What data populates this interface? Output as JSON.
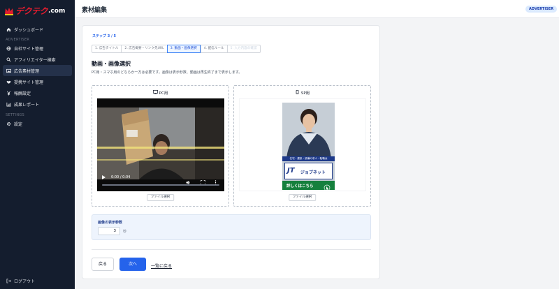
{
  "brand": {
    "logo_text": "デクテク",
    "logo_suffix": ".com",
    "accent_color": "#e11d2e"
  },
  "sidebar": {
    "main_items": [
      {
        "label": "ダッシュボード",
        "icon": "home-icon"
      }
    ],
    "sections": [
      {
        "title": "ADVERTISER",
        "items": [
          {
            "label": "自社サイト管理",
            "icon": "globe-icon"
          },
          {
            "label": "アフィリエイター検索",
            "icon": "search-icon"
          },
          {
            "label": "広告素材管理",
            "icon": "image-icon",
            "active": true
          },
          {
            "label": "提携サイト管理",
            "icon": "handshake-icon"
          },
          {
            "label": "報酬設定",
            "icon": "yen-icon"
          },
          {
            "label": "成果レポート",
            "icon": "chart-icon"
          }
        ]
      },
      {
        "title": "SETTINGS",
        "items": [
          {
            "label": "設定",
            "icon": "gear-icon"
          }
        ]
      }
    ],
    "logout_label": "ログアウト"
  },
  "header": {
    "title": "素材編集",
    "role_badge": "ADVERTISER"
  },
  "wizard": {
    "step_label": "ステップ 3 / 5",
    "steps": [
      {
        "label": "1. 広告タイトル",
        "state": "done"
      },
      {
        "label": "2. 広告概要・リンク先URL",
        "state": "done"
      },
      {
        "label": "3. 動画・画像選択",
        "state": "current"
      },
      {
        "label": "4. 配信ルール",
        "state": "todo"
      },
      {
        "label": "5. 入力内容の確認",
        "state": "disabled"
      }
    ]
  },
  "media": {
    "title": "動画・画像選択",
    "description": "PC用・スマホ用のどちらか一方は必要です。画像は表示秒数、動画は再生終了まで表示します。",
    "pc": {
      "title": "PC用",
      "file_button": "ファイル選択",
      "video_time": "0:00 / 0:04",
      "progress": 0.0
    },
    "sp": {
      "title": "SP用",
      "file_button": "ファイル選択",
      "ad_text_top": "住宅・建設・設備の求人・転職は",
      "ad_brand": "ジョブネット",
      "ad_brand_mark": "JT",
      "ad_cta": "詳しくはこちら"
    }
  },
  "duration": {
    "label": "画像の表示秒数",
    "value": "3",
    "unit": "秒"
  },
  "actions": {
    "back_label": "戻る",
    "next_label": "次へ",
    "list_link": "一覧に戻る"
  }
}
